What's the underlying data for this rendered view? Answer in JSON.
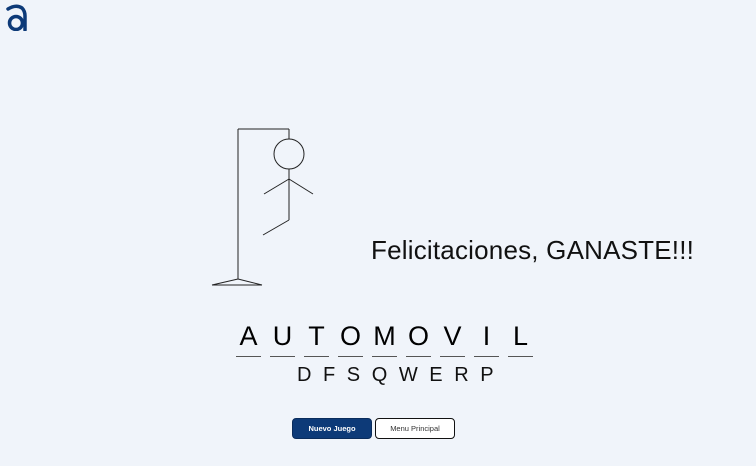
{
  "logo": {
    "icon": "brand-a-logo-icon",
    "color": "#0d3a78"
  },
  "game": {
    "message": "Felicitaciones, GANASTE!!!",
    "word_letters": [
      "A",
      "U",
      "T",
      "O",
      "M",
      "O",
      "V",
      "I",
      "L"
    ],
    "wrong_letters": [
      "D",
      "F",
      "S",
      "Q",
      "W",
      "E",
      "R",
      "P"
    ]
  },
  "buttons": {
    "new_game": "Nuevo Juego",
    "main_menu": "Menu Principal"
  },
  "colors": {
    "background": "#f0f4fa",
    "primary": "#0d3a78"
  }
}
